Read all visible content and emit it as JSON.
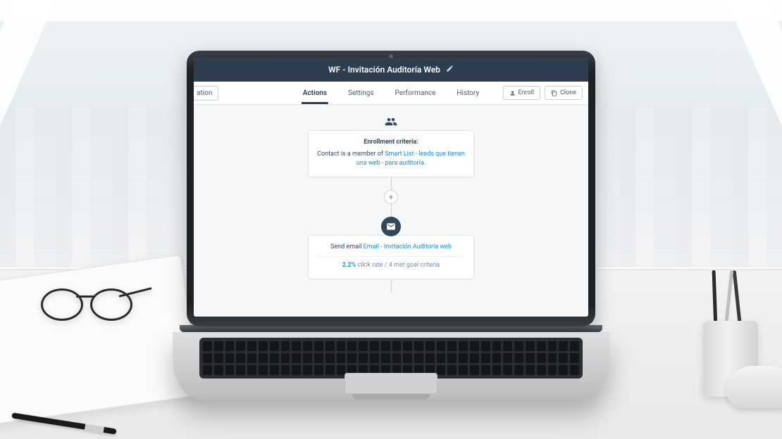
{
  "header": {
    "title": "WF - Invitación Auditoría Web"
  },
  "toolbar": {
    "left_button_fragment": "ation",
    "enroll_label": "Enroll",
    "clone_label": "Clone"
  },
  "tabs": [
    {
      "label": "Actions",
      "active": true
    },
    {
      "label": "Settings",
      "active": false
    },
    {
      "label": "Performance",
      "active": false
    },
    {
      "label": "History",
      "active": false
    }
  ],
  "workflow": {
    "enrollment": {
      "heading": "Enrollment criteria:",
      "prefix": "Contact is a member of ",
      "link": "Smart List - leads que tienen una web - para auditoría",
      "suffix": "."
    },
    "email_step": {
      "action_prefix": "Send email ",
      "email_link": "Email - Invitación Auditoría web",
      "click_rate": "2.2%",
      "stats_rest": " click rate / 4 met goal criteria"
    }
  }
}
